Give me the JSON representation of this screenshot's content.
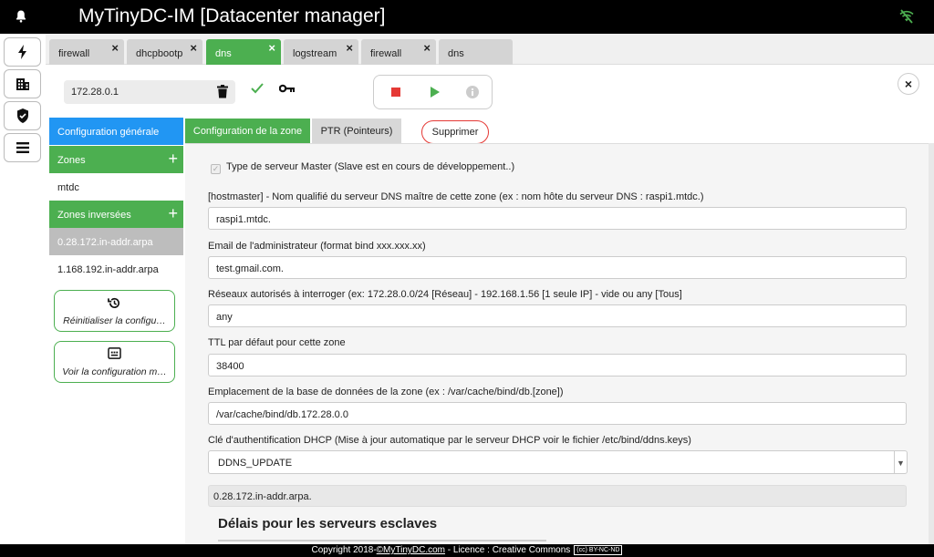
{
  "app": {
    "title": "MyTinyDC-IM [Datacenter manager]"
  },
  "rail": {
    "icons": [
      "bolt-icon",
      "building-icon",
      "shield-check-icon",
      "menu-icon"
    ]
  },
  "tabs": [
    {
      "label": "firewall",
      "close": "×",
      "active": false
    },
    {
      "label": "dhcpbootp",
      "close": "×",
      "active": false
    },
    {
      "label": "dns",
      "close": "×",
      "active": true
    },
    {
      "label": "logstream",
      "close": "×",
      "active": false
    },
    {
      "label": "firewall",
      "close": "×",
      "active": false
    },
    {
      "label": "dns",
      "close": "",
      "active": false
    }
  ],
  "toolbar": {
    "host": "172.28.0.1",
    "close": "×"
  },
  "sidebar": {
    "general": "Configuration générale",
    "zones_header": "Zones",
    "zones": [
      "mtdc"
    ],
    "reverse_header": "Zones inversées",
    "reverse_zones": [
      "0.28.172.in-addr.arpa",
      "1.168.192.in-addr.arpa"
    ],
    "reset_label": "Réinitialiser la configu…",
    "view_label": "Voir la configuration m…"
  },
  "content_tabs": {
    "zone_config": "Configuration de la zone",
    "ptr": "PTR (Pointeurs)",
    "delete": "Supprimer"
  },
  "form": {
    "master_checkbox": "Type de serveur Master (Slave est en cours de développement..)",
    "hostmaster_label": "[hostmaster] - Nom qualifié du serveur DNS maître de cette zone (ex : nom hôte du serveur DNS : raspi1.mtdc.)",
    "hostmaster_value": "raspi1.mtdc.",
    "email_label": "Email de l'administrateur (format bind xxx.xxx.xx)",
    "email_value": "test.gmail.com.",
    "networks_label": "Réseaux autorisés à interroger (ex: 172.28.0.0/24 [Réseau] - 192.168.1.56 [1 seule IP] - vide ou any [Tous]",
    "networks_value": "any",
    "ttl_label": "TTL par défaut pour cette zone",
    "ttl_value": "38400",
    "db_label": "Emplacement de la base de données de la zone (ex : /var/cache/bind/db.[zone])",
    "db_value": "/var/cache/bind/db.172.28.0.0",
    "dhcp_key_label": "Clé d'authentification DHCP (Mise à jour automatique par le serveur DHCP voir le fichier /etc/bind/ddns.keys)",
    "dhcp_key_value": "DDNS_UPDATE",
    "zone_name_value": "0.28.172.in-addr.arpa.",
    "slaves_heading": "Délais pour les serveurs esclaves"
  },
  "footer": {
    "prefix": "Copyright 2018-",
    "link": "©MyTinyDC.com",
    "suffix": " - Licence : Creative Commons",
    "badge": "(cc) BY-NC-ND"
  },
  "colors": {
    "green": "#4caf50",
    "blue": "#2196f3",
    "red": "#e53935",
    "wifi_off": "#4caf50"
  }
}
